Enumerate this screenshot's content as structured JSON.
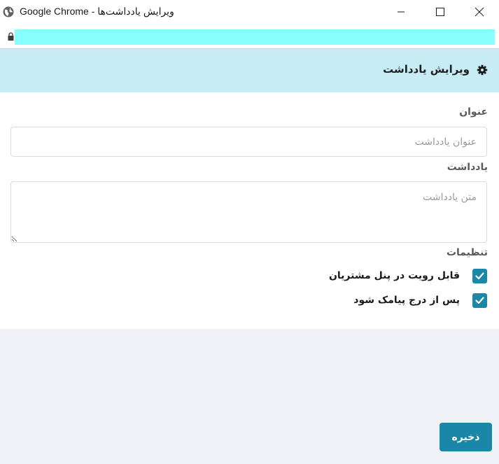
{
  "window": {
    "title": "Google Chrome - ویرایش یادداشت‌ها",
    "minimize_icon": "minimize-icon",
    "maximize_icon": "maximize-icon",
    "close_icon": "close-icon"
  },
  "addressbar": {
    "lock_icon": "lock-icon",
    "url_color": "#88ffff"
  },
  "header": {
    "title": "ویرایش یادداشت",
    "icon": "gear-icon",
    "background": "#c8ecf4"
  },
  "form": {
    "title_label": "عنوان",
    "title_value": "",
    "title_placeholder": "عنوان یادداشت",
    "note_label": "یادداشت",
    "note_value": "",
    "note_placeholder": "متن یادداشت",
    "settings_label": "تنظیمات",
    "checkboxes": [
      {
        "label": "قابل رویت در پنل مشتریان",
        "checked": true
      },
      {
        "label": "پس از درج پیامک شود",
        "checked": true
      }
    ]
  },
  "actions": {
    "save_label": "ذخیره"
  },
  "colors": {
    "accent": "#1a86a8",
    "page_bg": "#eff1f7"
  }
}
